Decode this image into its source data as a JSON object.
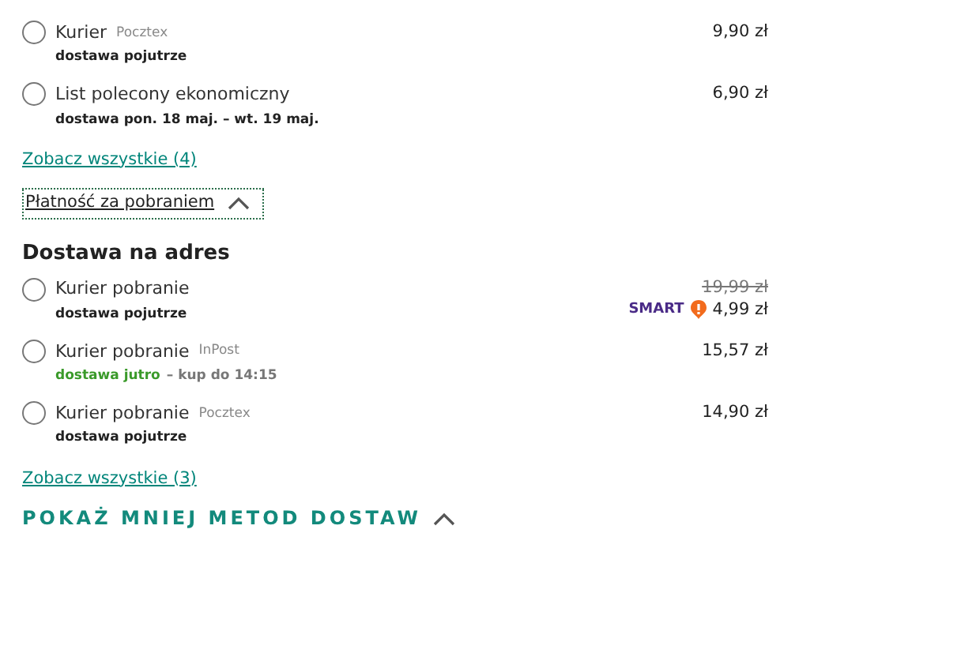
{
  "groups": [
    {
      "options": [
        {
          "name": "Kurier",
          "carrier": "Pocztex",
          "delivery": "dostawa pojutrze",
          "fast": false,
          "price": "9,90 zł",
          "selected": false
        },
        {
          "name": "List polecony ekonomiczny",
          "delivery": "dostawa pon. 18 maj. – wt. 19 maj.",
          "fast": false,
          "price": "6,90 zł",
          "selected": false
        }
      ],
      "see_all": "Zobacz wszystkie (4)"
    },
    {
      "toggle": {
        "label": "Płatność za pobraniem",
        "expanded": true
      },
      "heading": "Dostawa na adres",
      "options": [
        {
          "name": "Kurier pobranie",
          "delivery": "dostawa pojutrze",
          "fast": false,
          "old_price": "19,99 zł",
          "smart": "SMART",
          "price": "4,99 zł",
          "selected": false
        },
        {
          "name": "Kurier pobranie",
          "carrier": "InPost",
          "delivery": "dostawa jutro",
          "fast": true,
          "cutoff": "– kup do 14:15",
          "price": "15,57 zł",
          "selected": false
        },
        {
          "name": "Kurier pobranie",
          "carrier": "Pocztex",
          "delivery": "dostawa pojutrze",
          "fast": false,
          "price": "14,90 zł",
          "selected": false
        }
      ],
      "see_all": "Zobacz wszystkie (3)"
    }
  ],
  "show_less": {
    "label": "POKAŻ MNIEJ METOD DOSTAW",
    "expanded": true
  }
}
